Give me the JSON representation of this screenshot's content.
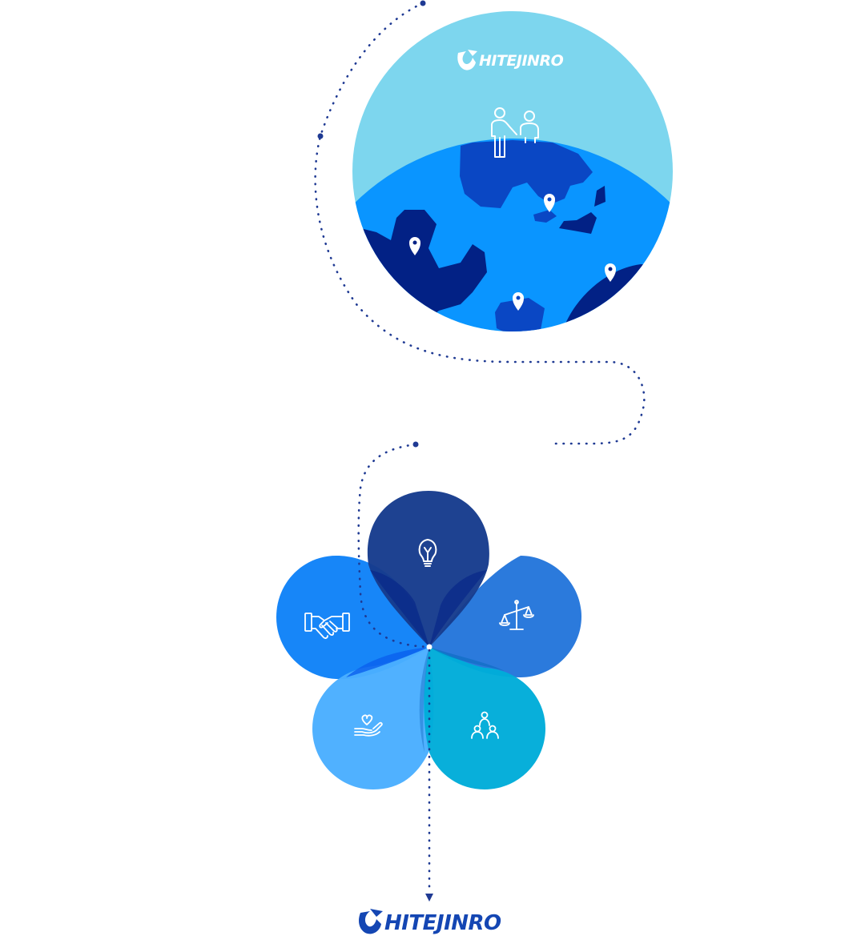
{
  "logos": {
    "top": {
      "text": "HITEJINRO"
    },
    "bottom": {
      "text": "HITEJINRO"
    }
  },
  "colors": {
    "dotted_line": "#1f3a93",
    "globe_sky": "#7dd6ee",
    "globe_ocean": "#0a95ff",
    "globe_land_dark": "#022185",
    "globe_land_mid": "#0a47c4",
    "logo_blue": "#1446b3",
    "petal_top": "#173c8d",
    "petal_right": "#2476db",
    "petal_left": "#0f82f8",
    "petal_bottom_left": "#4aaeff",
    "petal_bottom_right": "#00acd9"
  },
  "icons": {
    "globe_people": "people-icon",
    "map_pins": [
      "map-pin-icon",
      "map-pin-icon",
      "map-pin-icon",
      "map-pin-icon"
    ],
    "petals": [
      "lightbulb-icon",
      "balance-scale-icon",
      "handshake-icon",
      "heart-in-hand-icon",
      "family-icon"
    ]
  }
}
